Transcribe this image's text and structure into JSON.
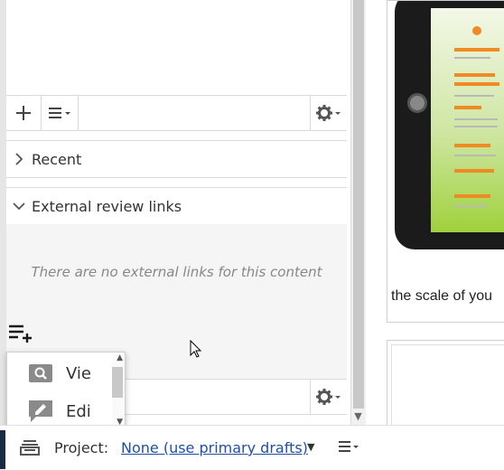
{
  "left_panel": {
    "sections": {
      "recent": {
        "label": "Recent"
      },
      "external_review": {
        "label": "External review links",
        "empty_message": "There are no external links for this content"
      }
    }
  },
  "popup_menu": {
    "items": [
      {
        "label": "Vie",
        "icon": "search-icon"
      },
      {
        "label": "Edi",
        "icon": "edit-icon"
      }
    ]
  },
  "preview": {
    "caption": "the scale of you"
  },
  "bottom_bar": {
    "project_label": "Project:",
    "project_value": "None (use primary drafts)"
  },
  "colors": {
    "link": "#1f4fa6",
    "tablet_accent": "#f08a24",
    "tablet_green": "#9fd13d"
  }
}
